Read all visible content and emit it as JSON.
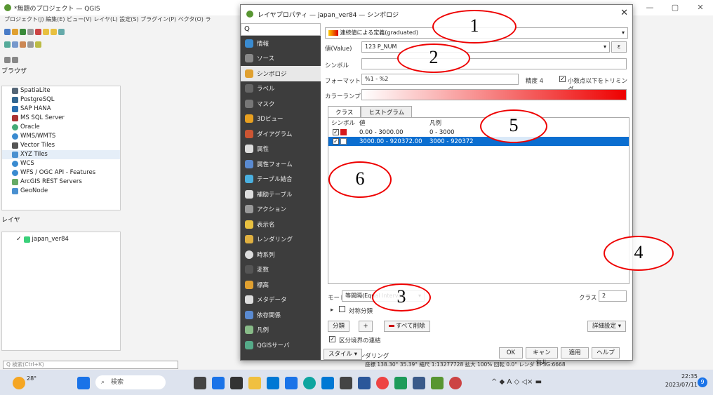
{
  "qgis": {
    "title": "*無題のプロジェクト — QGIS",
    "menu": "プロジェクト(J)  編集(E)  ビュー(V)  レイヤ(L)  設定(S)  プラグイン(P)  ベクタ(O)  ラ",
    "window_controls": [
      "—",
      "▢",
      "✕"
    ],
    "browser_title": "ブラウザ",
    "browser_items": [
      "SpatiaLite",
      "PostgreSQL",
      "SAP HANA",
      "MS SQL Server",
      "Oracle",
      "WMS/WMTS",
      "Vector Tiles",
      "XYZ Tiles",
      "WCS",
      "WFS / OGC API - Features",
      "ArcGIS REST Servers",
      "GeoNode"
    ],
    "layers_title": "レイヤ",
    "layer_name": "japan_ver84",
    "locator_placeholder": "Q 検索(Ctrl+K)",
    "status": "座標 138.30° 35.39°  縮尺 1:13277728  拡大 100%  回転 0.0°  レンダ  EPSG:6668"
  },
  "dialog": {
    "title": "レイヤプロパティ — japan_ver84 — シンボロジ",
    "close": "✕",
    "search_placeholder": "Q",
    "categories": [
      "情報",
      "ソース",
      "シンボロジ",
      "ラベル",
      "マスク",
      "3Dビュー",
      "ダイアグラム",
      "属性",
      "属性フォーム",
      "テーブル結合",
      "補助テーブル",
      "アクション",
      "表示名",
      "レンダリング",
      "時系列",
      "変数",
      "標高",
      "メタデータ",
      "依存関係",
      "凡例",
      "QGISサーバ"
    ],
    "renderer": "連続値による定義(graduated)",
    "value_label": "値(Value)",
    "value": "123 P_NUM",
    "symbol_label": "シンボル",
    "format_label": "フォーマット",
    "format_value": "%1 - %2",
    "precision": "精度 4",
    "trim_label": "小数点以下をトリミング",
    "ramp_label": "カラーランプ",
    "tabs": [
      "クラス",
      "ヒストグラム"
    ],
    "table_headers": [
      "シンボル",
      "値",
      "凡例"
    ],
    "classes": [
      {
        "value": "0.00 - 3000.00",
        "legend": "0 - 3000",
        "color": "#d7191c",
        "checked": true
      },
      {
        "value": "3000.00 - 920372.00",
        "legend": "3000 - 920372",
        "color": "#ffffff",
        "checked": true
      }
    ],
    "mode_label": "モード",
    "mode_value": "等間隔(Equal Interval)",
    "classes_label": "クラス",
    "classes_count": "2",
    "symmetric_label": "対称分類",
    "classify_btn": "分類",
    "add_btn": "+",
    "delete_all_btn": "すべて削除",
    "advanced_btn": "詳細設定 ▾",
    "link_boundaries": "区分境界の連結",
    "layer_rendering": "レイヤレンダリング",
    "style_btn": "スタイル ▾",
    "ok": "OK",
    "cancel": "キャンセル",
    "apply": "適用",
    "help": "ヘルプ"
  },
  "annotations": [
    "1",
    "2",
    "3",
    "4",
    "5",
    "6"
  ],
  "taskbar": {
    "temp": "28°",
    "search": "検索",
    "time": "22:35",
    "date": "2023/07/11",
    "notif": "9"
  }
}
